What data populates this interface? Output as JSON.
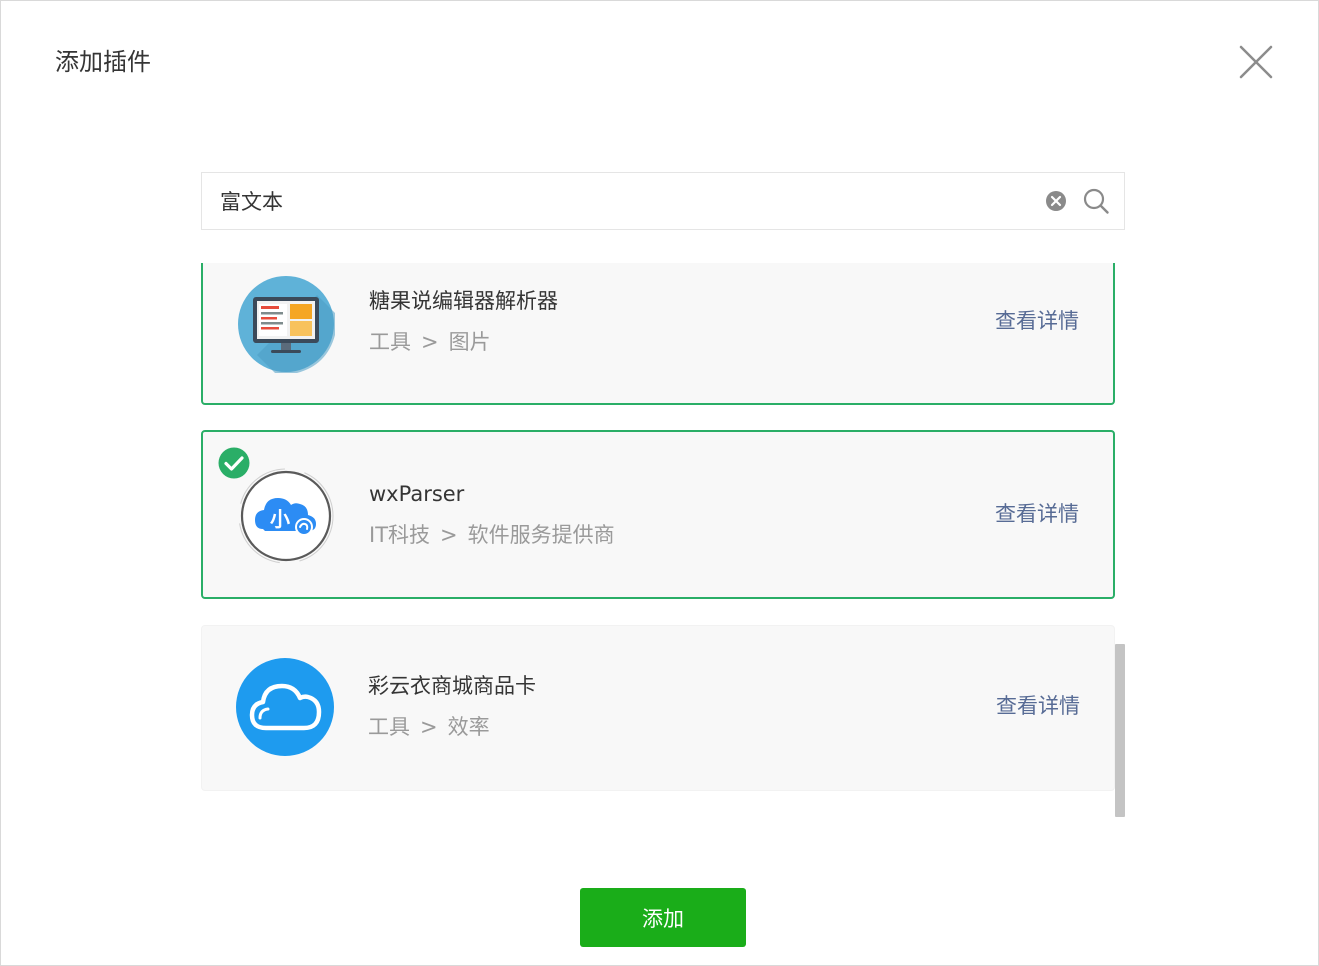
{
  "dialog": {
    "title": "添加插件",
    "close_icon": "close-icon"
  },
  "search": {
    "value": "富文本",
    "clear_icon": "clear-icon",
    "search_icon": "search-icon"
  },
  "plugins": [
    {
      "name": "糖果说编辑器解析器",
      "category": "工具",
      "subcategory": "图片",
      "separator": ">",
      "detail_label": "查看详情",
      "selected": false,
      "icon": "monitor-editor-icon"
    },
    {
      "name": "wxParser",
      "category": "IT科技",
      "subcategory": "软件服务提供商",
      "separator": ">",
      "detail_label": "查看详情",
      "selected": true,
      "icon": "cloud-mini-program-icon"
    },
    {
      "name": "彩云衣商城商品卡",
      "category": "工具",
      "subcategory": "效率",
      "separator": ">",
      "detail_label": "查看详情",
      "selected": false,
      "icon": "blue-cloud-icon"
    }
  ],
  "footer": {
    "add_label": "添加"
  },
  "colors": {
    "accent_green": "#1aad19",
    "selected_border": "#2aae67",
    "link_blue": "#576b95"
  }
}
